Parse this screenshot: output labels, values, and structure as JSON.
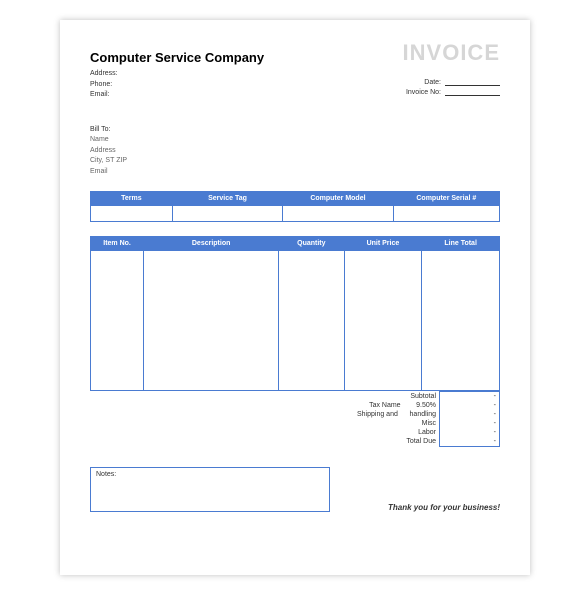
{
  "title": "INVOICE",
  "company": {
    "name": "Computer Service Company",
    "address_label": "Address:",
    "phone_label": "Phone:",
    "email_label": "Email:"
  },
  "meta": {
    "date_label": "Date:",
    "invoice_no_label": "Invoice No:"
  },
  "billto": {
    "header": "Bill To:",
    "name": "Name",
    "address": "Address",
    "citystzip": "City, ST ZIP",
    "email": "Email"
  },
  "service_table": {
    "headers": [
      "Terms",
      "Service Tag",
      "Computer Model",
      "Computer Serial #"
    ]
  },
  "items_table": {
    "headers": [
      "Item No.",
      "Description",
      "Quantity",
      "Unit Price",
      "Line Total"
    ]
  },
  "totals": {
    "tax_name_label": "Tax Name",
    "shipping_label": "Shipping and",
    "rows": [
      {
        "label": "Subtotal",
        "value": "-"
      },
      {
        "label": "9.50%",
        "value": "-"
      },
      {
        "label": "handling",
        "value": "-"
      },
      {
        "label": "Misc",
        "value": "-"
      },
      {
        "label": "Labor",
        "value": "-"
      },
      {
        "label": "Total Due",
        "value": "-"
      }
    ]
  },
  "notes_label": "Notes:",
  "thanks": "Thank you for your business!"
}
